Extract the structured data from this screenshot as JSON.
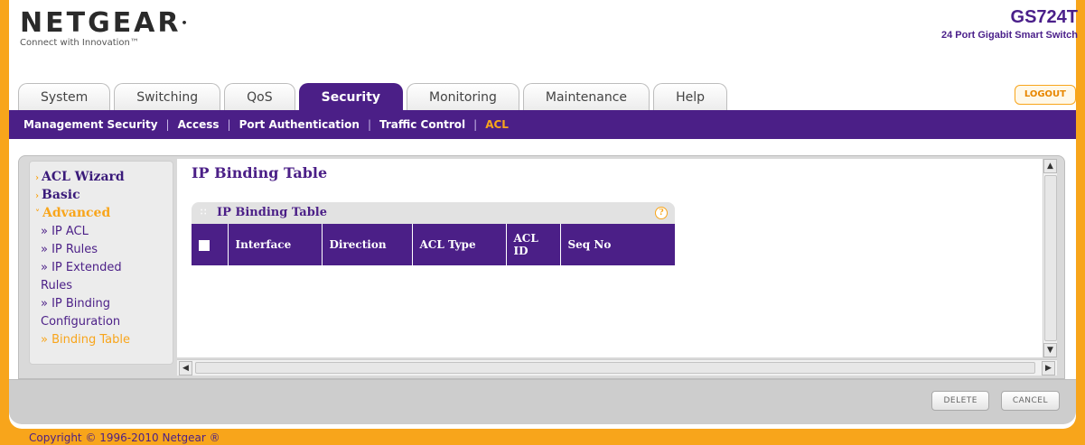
{
  "brand": {
    "logo": "NETGEAR",
    "tagline": "Connect with Innovation™"
  },
  "model": {
    "name": "GS724T",
    "description": "24 Port Gigabit Smart Switch"
  },
  "tabs": [
    {
      "label": "System"
    },
    {
      "label": "Switching"
    },
    {
      "label": "QoS"
    },
    {
      "label": "Security",
      "active": true
    },
    {
      "label": "Monitoring"
    },
    {
      "label": "Maintenance"
    },
    {
      "label": "Help"
    }
  ],
  "logout_label": "LOGOUT",
  "subnav": [
    {
      "label": "Management Security"
    },
    {
      "label": "Access"
    },
    {
      "label": "Port Authentication"
    },
    {
      "label": "Traffic Control"
    },
    {
      "label": "ACL",
      "active": true
    }
  ],
  "sidebar": {
    "main_items": [
      {
        "label": "ACL Wizard"
      },
      {
        "label": "Basic"
      },
      {
        "label": "Advanced",
        "active": true
      }
    ],
    "sub_items": [
      {
        "label": "» IP ACL"
      },
      {
        "label": "» IP Rules"
      },
      {
        "label": "» IP Extended",
        "label2": "Rules"
      },
      {
        "label": "» IP Binding",
        "label2": "Configuration"
      },
      {
        "label": "» Binding Table",
        "active": true
      }
    ]
  },
  "page_title": "IP Binding Table",
  "table": {
    "title": "IP Binding Table",
    "help_icon": "?",
    "columns": [
      "Interface",
      "Direction",
      "ACL Type",
      "ACL ID",
      "Seq No"
    ]
  },
  "buttons": {
    "delete": "DELETE",
    "cancel": "CANCEL"
  },
  "copyright": "Copyright © 1996-2010 Netgear ®",
  "colors": {
    "accent_purple": "#4b1f87",
    "accent_orange": "#F8A51B"
  }
}
